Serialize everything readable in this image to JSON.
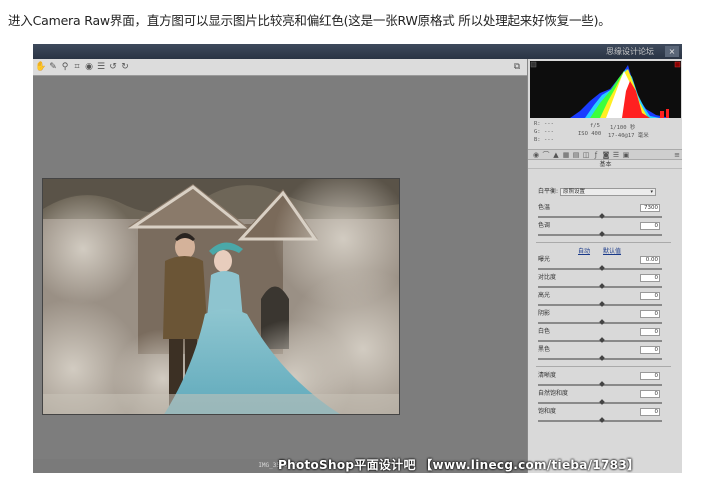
{
  "caption": "进入Camera Raw界面，直方图可以显示图片比较亮和偏红色(这是一张RW原格式 所以处理起来好恢复一些)。",
  "window": {
    "title_watermark": "思缘设计论坛",
    "close_glyph": "×",
    "toolbar_icons": [
      "hand-icon",
      "eyedropper-icon",
      "white-balance-icon",
      "crop-icon",
      "straighten-icon",
      "list-icon",
      "rotate-left-icon",
      "rotate-right-icon"
    ],
    "filename": "IMG_3536.CR2"
  },
  "histogram_colors": {
    "blue": "#1a3cff",
    "cyan": "#2ad0ff",
    "green": "#3cff3c",
    "yellow": "#ffee22",
    "red": "#ff2020",
    "white": "#ffffff"
  },
  "metadata": {
    "r": "R:",
    "g": "G:",
    "b": "B:",
    "r_val": "---",
    "g_val": "---",
    "b_val": "---",
    "aperture": "f/5",
    "shutter": "1/100 秒",
    "iso": "ISO 400",
    "lens": "17-40@17 毫米"
  },
  "panel": {
    "section_title": "基本",
    "white_balance_label": "白平衡:",
    "white_balance_value": "原照设置",
    "auto_link": "自动",
    "default_link": "默认值",
    "controls": [
      {
        "label": "色温",
        "value": "7300"
      },
      {
        "label": "色调",
        "value": "0"
      },
      {
        "label": "曝光",
        "value": "0.00"
      },
      {
        "label": "对比度",
        "value": "0"
      },
      {
        "label": "高光",
        "value": "0"
      },
      {
        "label": "阴影",
        "value": "0"
      },
      {
        "label": "白色",
        "value": "0"
      },
      {
        "label": "黑色",
        "value": "0"
      },
      {
        "label": "清晰度",
        "value": "0"
      },
      {
        "label": "自然饱和度",
        "value": "0"
      },
      {
        "label": "饱和度",
        "value": "0"
      }
    ]
  },
  "watermark": "PhotoShop平面设计吧 【www.linecg.com/tieba/1783】"
}
